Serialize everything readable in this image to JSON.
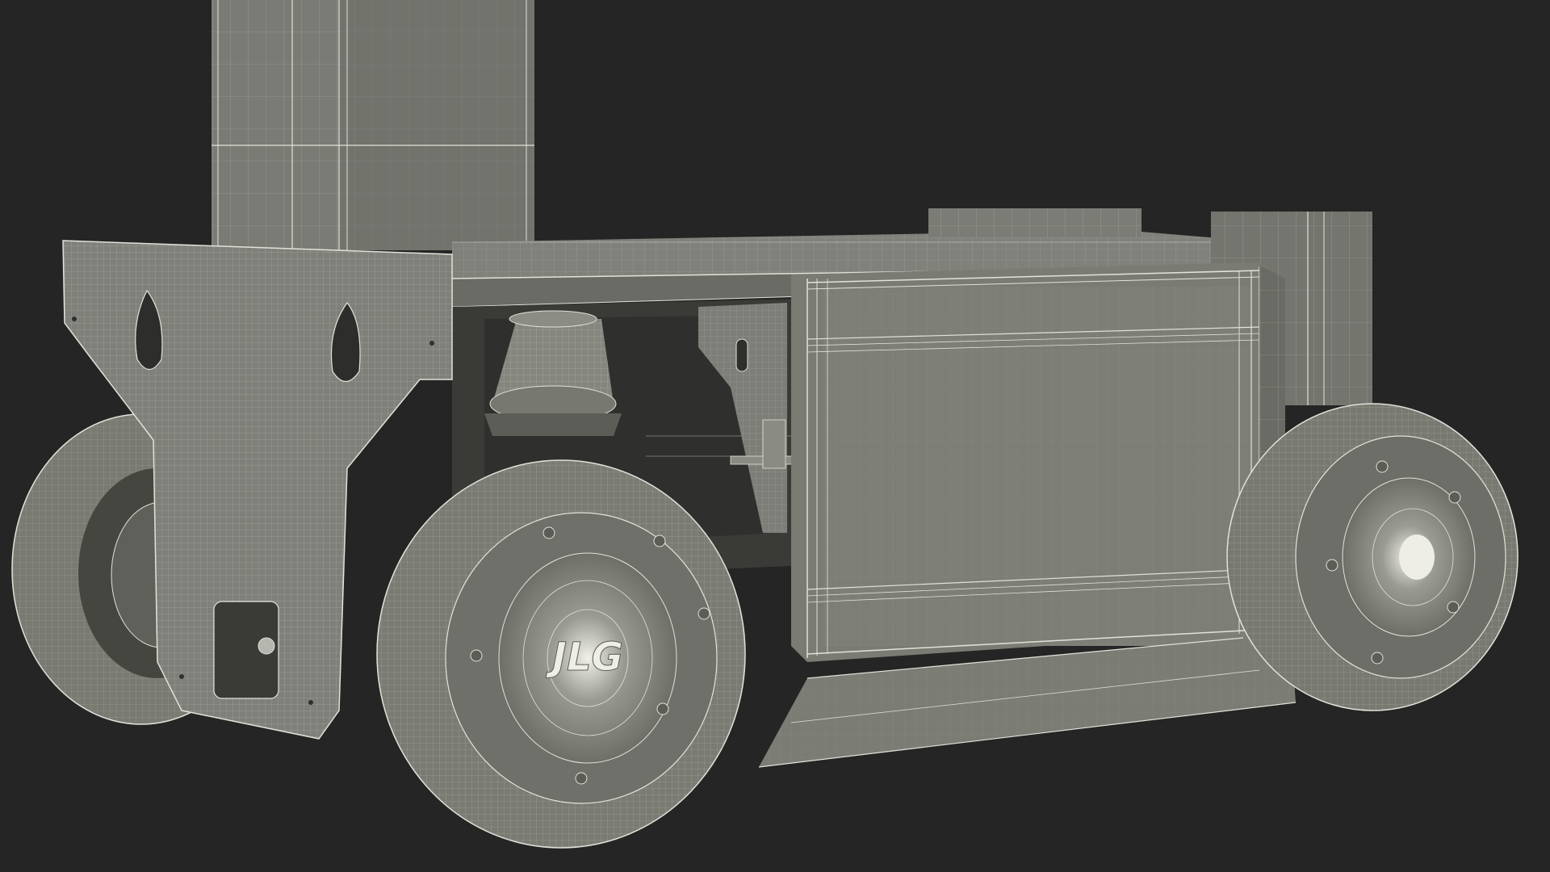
{
  "scene": {
    "background": "#252525",
    "surface_color": "#767770",
    "surface_dark": "#5f605a",
    "surface_light": "#8a8b83",
    "shadow_color": "#2f302d",
    "wire_color": "#e2e2da",
    "hub_logo_text": "JLG"
  }
}
